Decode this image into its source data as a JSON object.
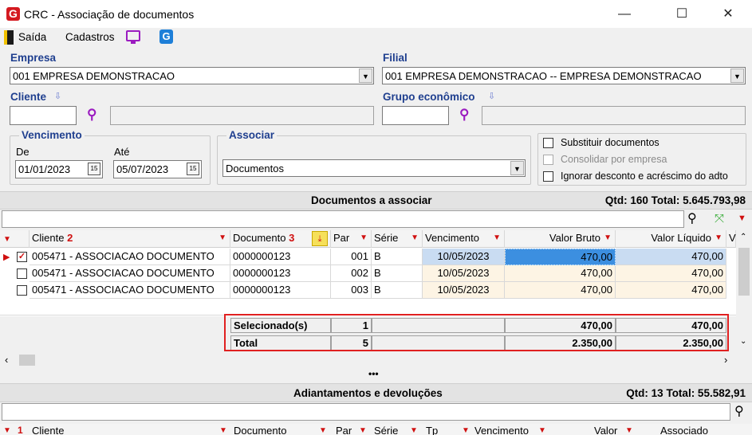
{
  "window": {
    "title": "CRC - Associação de documentos",
    "minimize": "—",
    "maximize": "☐",
    "close": "✕"
  },
  "menu": {
    "exit": "Saída",
    "registers": "Cadastros"
  },
  "filters": {
    "company_label": "Empresa",
    "company_value": "001 EMPRESA DEMONSTRACAO",
    "branch_label": "Filial",
    "branch_value": "001 EMPRESA DEMONSTRACAO -- EMPRESA DEMONSTRACAO",
    "client_label": "Cliente",
    "economic_group_label": "Grupo econômico",
    "due_label": "Vencimento",
    "from_label": "De",
    "from_value": "01/01/2023",
    "to_label": "Até",
    "to_value": "05/07/2023",
    "associate_label": "Associar",
    "associate_value": "Documentos",
    "replace_docs": "Substituir documentos",
    "consolidate": "Consolidar por empresa",
    "ignore_discount": "Ignorar desconto e acréscimo do adto"
  },
  "docs_section": {
    "title": "Documentos a associar",
    "summary": "Qtd: 160 Total: 5.645.793,98",
    "headers": {
      "client": "Cliente",
      "client_sort": "2",
      "document": "Documento",
      "document_sort": "3",
      "par": "Par",
      "serie": "Série",
      "due": "Vencimento",
      "gross": "Valor Bruto",
      "net": "Valor Líquido",
      "extra": "V"
    },
    "rows": [
      {
        "client": "005471 - ASSOCIACAO DOCUMENTO",
        "document": "0000000123",
        "par": "001",
        "serie": "B",
        "due": "10/05/2023",
        "gross": "470,00",
        "net": "470,00",
        "checked": true
      },
      {
        "client": "005471 - ASSOCIACAO DOCUMENTO",
        "document": "0000000123",
        "par": "002",
        "serie": "B",
        "due": "10/05/2023",
        "gross": "470,00",
        "net": "470,00",
        "checked": false
      },
      {
        "client": "005471 - ASSOCIACAO DOCUMENTO",
        "document": "0000000123",
        "par": "003",
        "serie": "B",
        "due": "10/05/2023",
        "gross": "470,00",
        "net": "470,00",
        "checked": false
      }
    ],
    "selected": {
      "label": "Selecionado(s)",
      "count": "1",
      "gross": "470,00",
      "net": "470,00"
    },
    "total": {
      "label": "Total",
      "count": "5",
      "gross": "2.350,00",
      "net": "2.350,00"
    }
  },
  "splitter": "•••",
  "adv_section": {
    "title": "Adiantamentos e devoluções",
    "summary": "Qtd: 13 Total: 55.582,91",
    "headers": {
      "sort": "1",
      "client": "Cliente",
      "document": "Documento",
      "par": "Par",
      "serie": "Série",
      "tp": "Tp",
      "due": "Vencimento",
      "value": "Valor",
      "associated": "Associado"
    }
  }
}
